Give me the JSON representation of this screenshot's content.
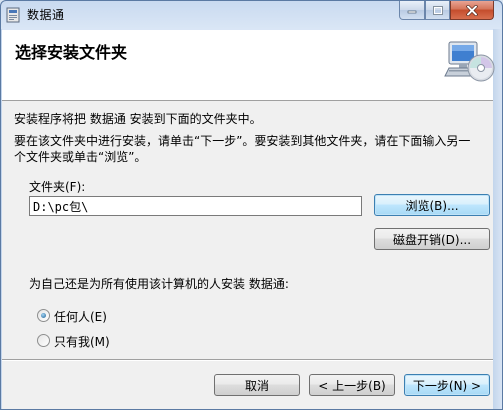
{
  "window": {
    "title": "数据通",
    "icons": {
      "app": "installer-icon",
      "minimize": "minimize-icon",
      "maximize": "maximize-icon",
      "close": "close-icon"
    }
  },
  "header": {
    "title": "选择安装文件夹",
    "icon": "computer-cd-setup-icon"
  },
  "body": {
    "intro_line": "安装程序将把 数据通 安装到下面的文件夹中。",
    "instructions_line1": "要在该文件夹中进行安装，请单击“下一步”。要安装到其他文件夹，请在下面输入另一",
    "instructions_line2": "个文件夹或单击“浏览”。",
    "folder_label": "文件夹(F):",
    "folder_value": "D:\\pc包\\",
    "browse_label": "浏览(B)...",
    "disk_cost_label": "磁盘开销(D)...",
    "install_for_question": "为自己还是为所有使用该计算机的人安装 数据通:",
    "radio_everyone": "任何人(E)",
    "radio_just_me": "只有我(M)",
    "selected_option": "任何人(E)"
  },
  "footer": {
    "cancel_label": "取消",
    "back_label": "< 上一步(B)",
    "next_label": "下一步(N) >"
  },
  "colors": {
    "title_bar": "#d5e2f2",
    "header_bg": "#ffffff",
    "body_bg": "#f0f0f0",
    "close_button": "#c44d2c",
    "focused_button_border": "#3c7fb1",
    "radio_dot": "#1a5d92"
  }
}
